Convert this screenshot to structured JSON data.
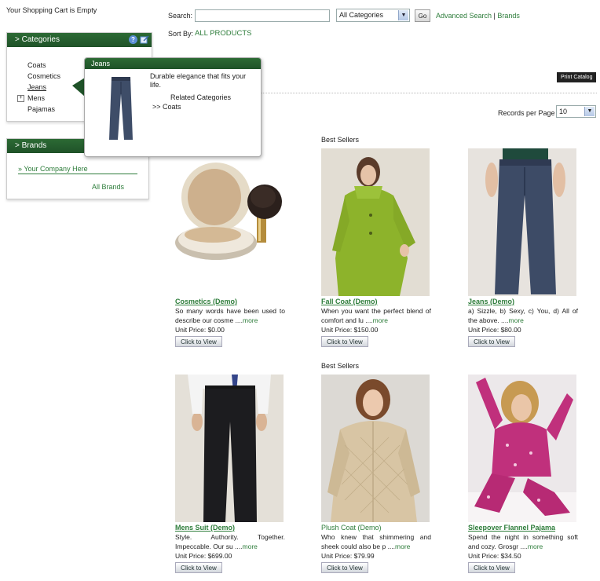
{
  "cart": {
    "status": "Your Shopping Cart is Empty"
  },
  "search": {
    "label": "Search:",
    "value": "",
    "placeholder": "",
    "category": "All Categories",
    "go_label": "Go",
    "advanced_label": "Advanced Search",
    "brands_label": "Brands",
    "sort_label": "Sort By:",
    "sort_value": "ALL PRODUCTS"
  },
  "sidebar": {
    "categories_title": "Categories",
    "categories": [
      {
        "label": "Coats"
      },
      {
        "label": "Cosmetics"
      },
      {
        "label": "Jeans"
      },
      {
        "label": "Mens"
      },
      {
        "label": "Pajamas"
      }
    ],
    "brands_title": "Brands",
    "brand_item": "Your Company Here",
    "all_brands": "All Brands"
  },
  "tooltip": {
    "title": "Jeans",
    "description": "Durable elegance that fits your life.",
    "related_label": "Related Categories",
    "related_item": ">> Coats"
  },
  "main": {
    "print_catalog": "Print Catalog",
    "records_label": "Records per Page",
    "records_value": "10",
    "section_label": "Best Sellers",
    "products": [
      {
        "title": "Cosmetics (Demo)",
        "desc": "So many words have been used to describe our cosme ....",
        "more": "more",
        "price": "Unit Price: $0.00",
        "button": "Click to View"
      },
      {
        "title": "Fall Coat (Demo)",
        "desc": "When you want the perfect blend of comfort and lu ....",
        "more": "more",
        "price": "Unit Price: $150.00",
        "button": "Click to View"
      },
      {
        "title": "Jeans (Demo)",
        "desc": "a) Sizzle, b) Sexy, c) You, d) All of the above. ....",
        "more": "more",
        "price": "Unit Price: $80.00",
        "button": "Click to View"
      },
      {
        "title": "Mens Suit (Demo)",
        "desc": "Style. Authority. Together. Impeccable. Our su ....",
        "more": "more",
        "price": "Unit Price: $699.00",
        "button": "Click to View"
      },
      {
        "title": "Plush Coat (Demo)",
        "desc": "Who knew that shimmering and sheek could also be p ....",
        "more": "more",
        "price": "Unit Price: $79.99",
        "button": "Click to View"
      },
      {
        "title": "Sleepover Flannel Pajama",
        "desc": "Spend the night in something soft and cozy. Grosgr ....",
        "more": "more",
        "price": "Unit Price: $34.50",
        "button": "Click to View"
      }
    ]
  },
  "colors": {
    "brand_green": "#1f5228",
    "link_green": "#2e7d3b"
  }
}
